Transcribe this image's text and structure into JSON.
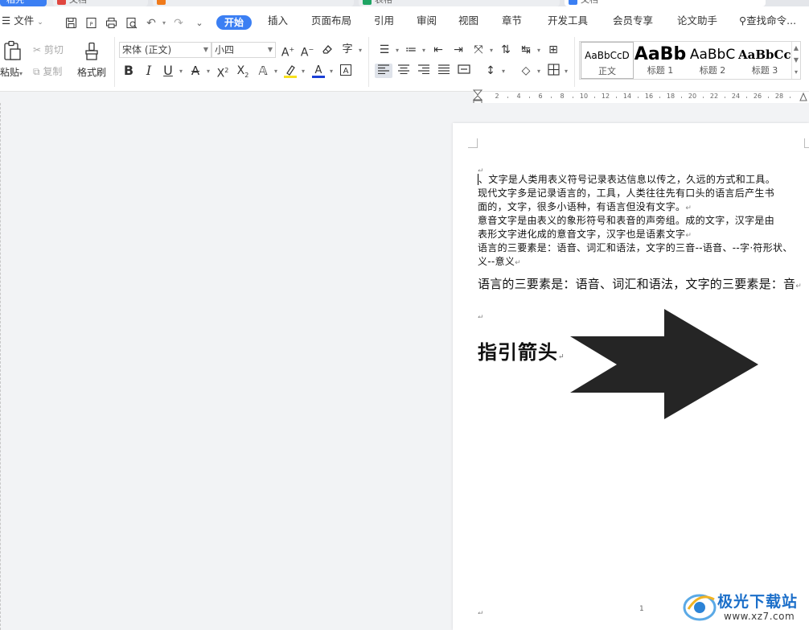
{
  "file_tabs": [
    {
      "label": "稻壳",
      "color": "#3b7ff3"
    },
    {
      "label": "文档",
      "color": "#e0463f"
    },
    {
      "label": "",
      "color": "#f07a1a"
    },
    {
      "label": "表格",
      "color": "#1fa463"
    },
    {
      "label": "文档",
      "color": "#3b7ff3"
    }
  ],
  "menu": {
    "file_label": "文件",
    "tabs": [
      "开始",
      "插入",
      "页面布局",
      "引用",
      "审阅",
      "视图",
      "章节",
      "开发工具",
      "会员专享",
      "论文助手"
    ],
    "active_tab": "开始",
    "search_label": "查找命令..."
  },
  "ribbon": {
    "paste_label": "粘贴",
    "cut_label": "剪切",
    "copy_label": "复制",
    "format_painter_label": "格式刷",
    "font_name": "宋体 (正文)",
    "font_size": "小四",
    "styles": [
      {
        "preview": "AaBbCcD",
        "name": "正文"
      },
      {
        "preview": "AaBb",
        "name": "标题 1"
      },
      {
        "preview": "AaBbC",
        "name": "标题 2"
      },
      {
        "preview": "AaBbCcI",
        "name": "标题 3"
      }
    ]
  },
  "ruler": {
    "ticks": [
      "2",
      "4",
      "6",
      "8",
      "10",
      "12",
      "14",
      "16",
      "18",
      "20",
      "22",
      "24",
      "26",
      "28"
    ]
  },
  "document": {
    "lines": [
      "、文字是人类用表义符号记录表达信息以传之，久远的方式和工具。",
      "现代文字多是记录语言的，工具，人类往往先有口头的语言后产生书",
      "面的，文字，很多小语种，有语言但没有文字。",
      "意音文字是由表义的象形符号和表音的声旁组。成的文字，汉字是由",
      "表形文字进化成的意音文字，汉字也是语素文字",
      "语言的三要素是：语音、词汇和语法，文字的三音--语音、--字·符形状、",
      "义--意义"
    ],
    "big_line": "语言的三要素是：语音、词汇和语法，文字的三要素是：音",
    "heading": "指引箭头",
    "page_number": "1"
  },
  "watermark": {
    "title": "极光下载站",
    "url": "www.xz7.com"
  }
}
